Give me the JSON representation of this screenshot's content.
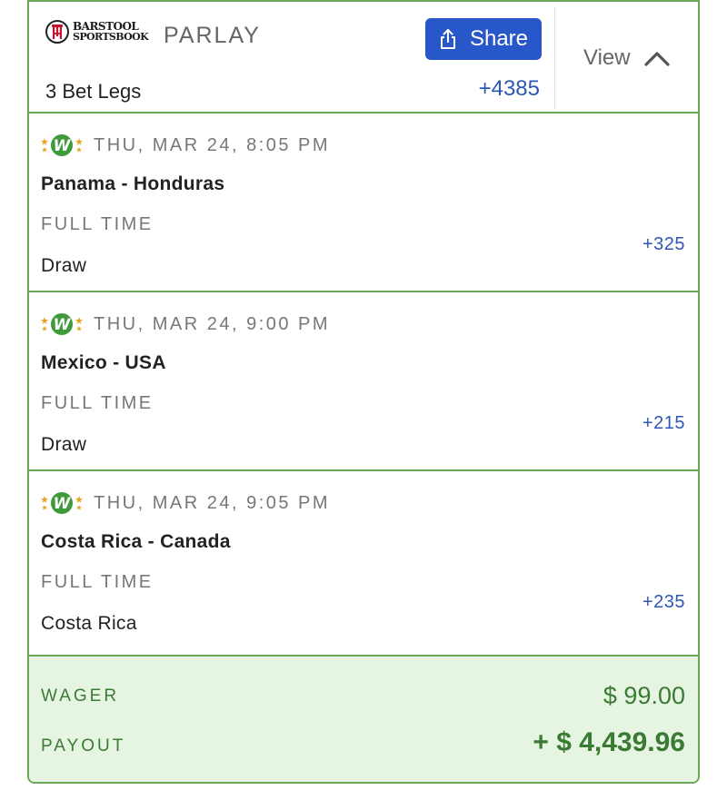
{
  "header": {
    "logo_line1": "BARSTOOL",
    "logo_line2": "SPORTSBOOK",
    "bet_type": "PARLAY",
    "share_label": "Share",
    "legs_count": "3 Bet Legs",
    "total_odds": "+4385",
    "view_label": "View"
  },
  "legs": [
    {
      "icon": "world-cup-qualifier-icon",
      "datetime": "THU, MAR 24, 8:05 PM",
      "match": "Panama - Honduras",
      "market": "FULL TIME",
      "pick": "Draw",
      "odds": "+325"
    },
    {
      "icon": "world-cup-qualifier-icon",
      "datetime": "THU, MAR 24, 9:00 PM",
      "match": "Mexico - USA",
      "market": "FULL TIME",
      "pick": "Draw",
      "odds": "+215"
    },
    {
      "icon": "world-cup-qualifier-icon",
      "datetime": "THU, MAR 24, 9:05 PM",
      "match": "Costa Rica - Canada",
      "market": "FULL TIME",
      "pick": "Costa Rica",
      "odds": "+235"
    }
  ],
  "summary": {
    "wager_label": "WAGER",
    "wager_value": "$ 99.00",
    "payout_label": "PAYOUT",
    "payout_value": "+ $ 4,439.96"
  },
  "colors": {
    "border_green": "#6aa85a",
    "share_blue": "#2757c9",
    "odds_blue": "#2d57b6",
    "summary_bg": "#e6f5e2",
    "summary_text": "#3a7a35"
  }
}
